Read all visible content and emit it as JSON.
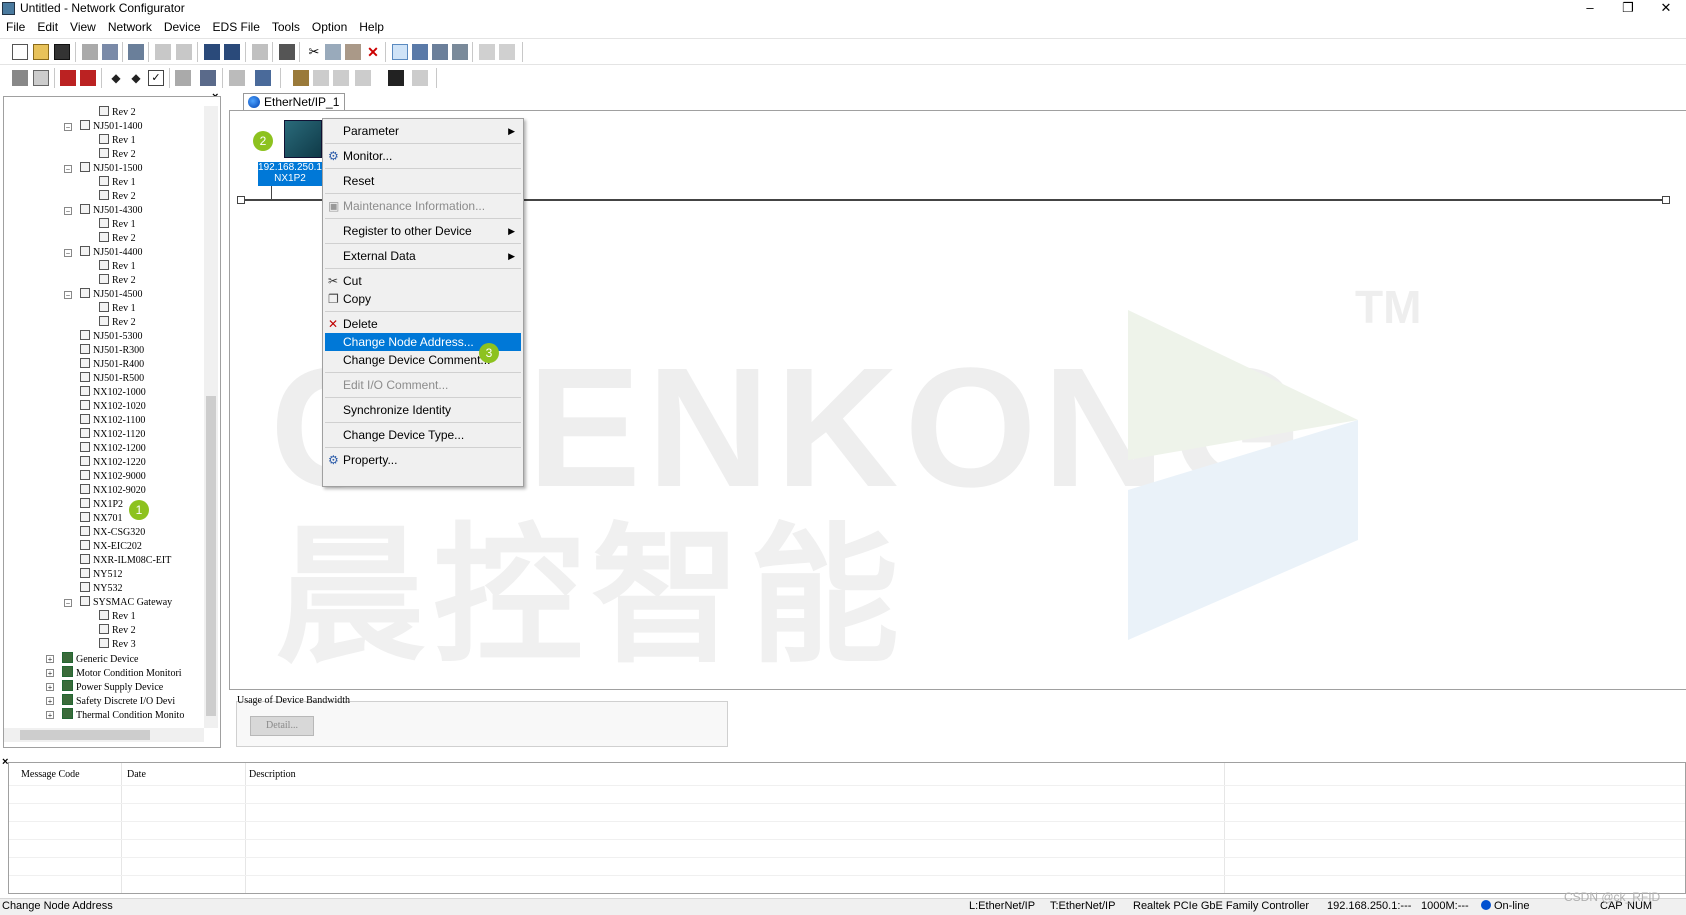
{
  "window": {
    "title": "Untitled - Network Configurator",
    "min": "–",
    "max": "❐",
    "close": "✕"
  },
  "menu": [
    "File",
    "Edit",
    "View",
    "Network",
    "Device",
    "EDS File",
    "Tools",
    "Option",
    "Help"
  ],
  "tab": {
    "label": "EtherNet/IP_1"
  },
  "tree": {
    "close": "×",
    "rows": [
      {
        "kind": "rev",
        "label": "Rev 2"
      },
      {
        "kind": "dev",
        "label": "NJ501-1400"
      },
      {
        "kind": "rev",
        "label": "Rev 1"
      },
      {
        "kind": "rev",
        "label": "Rev 2"
      },
      {
        "kind": "dev",
        "label": "NJ501-1500"
      },
      {
        "kind": "rev",
        "label": "Rev 1"
      },
      {
        "kind": "rev",
        "label": "Rev 2"
      },
      {
        "kind": "dev",
        "label": "NJ501-4300"
      },
      {
        "kind": "rev",
        "label": "Rev 1"
      },
      {
        "kind": "rev",
        "label": "Rev 2"
      },
      {
        "kind": "dev",
        "label": "NJ501-4400"
      },
      {
        "kind": "rev",
        "label": "Rev 1"
      },
      {
        "kind": "rev",
        "label": "Rev 2"
      },
      {
        "kind": "dev",
        "label": "NJ501-4500"
      },
      {
        "kind": "rev",
        "label": "Rev 1"
      },
      {
        "kind": "rev",
        "label": "Rev 2"
      },
      {
        "kind": "leaf",
        "label": "NJ501-5300"
      },
      {
        "kind": "leaf",
        "label": "NJ501-R300"
      },
      {
        "kind": "leaf",
        "label": "NJ501-R400"
      },
      {
        "kind": "leaf",
        "label": "NJ501-R500"
      },
      {
        "kind": "leaf",
        "label": "NX102-1000"
      },
      {
        "kind": "leaf",
        "label": "NX102-1020"
      },
      {
        "kind": "leaf",
        "label": "NX102-1100"
      },
      {
        "kind": "leaf",
        "label": "NX102-1120"
      },
      {
        "kind": "leaf",
        "label": "NX102-1200"
      },
      {
        "kind": "leaf",
        "label": "NX102-1220"
      },
      {
        "kind": "leaf",
        "label": "NX102-9000"
      },
      {
        "kind": "leaf",
        "label": "NX102-9020"
      },
      {
        "kind": "leaf",
        "label": "NX1P2"
      },
      {
        "kind": "leaf",
        "label": "NX701"
      },
      {
        "kind": "leaf",
        "label": "NX-CSG320"
      },
      {
        "kind": "leaf",
        "label": "NX-EIC202"
      },
      {
        "kind": "leaf",
        "label": "NXR-ILM08C-EIT"
      },
      {
        "kind": "leaf",
        "label": "NY512"
      },
      {
        "kind": "leaf",
        "label": "NY532"
      },
      {
        "kind": "dev",
        "label": "SYSMAC Gateway"
      },
      {
        "kind": "rev",
        "label": "Rev 1"
      },
      {
        "kind": "rev",
        "label": "Rev 2"
      },
      {
        "kind": "rev",
        "label": "Rev 3"
      },
      {
        "kind": "group",
        "label": "Generic Device"
      },
      {
        "kind": "group",
        "label": "Motor Condition Monitori"
      },
      {
        "kind": "group",
        "label": "Power Supply Device"
      },
      {
        "kind": "group",
        "label": "Safety Discrete I/O Devi"
      },
      {
        "kind": "group",
        "label": "Thermal Condition Monito"
      }
    ]
  },
  "badges": {
    "one": "1",
    "two": "2",
    "three": "3"
  },
  "device": {
    "ip": "192.168.250.1",
    "name": "NX1P2"
  },
  "watermark": {
    "text": "CHENKONG",
    "tm": "TM",
    "cn": "晨控智能"
  },
  "context_menu": {
    "items": [
      {
        "label": "Parameter",
        "submenu": true
      },
      {
        "sep": true
      },
      {
        "label": "Monitor...",
        "icon": "monitor-icon"
      },
      {
        "sep": true
      },
      {
        "label": "Reset"
      },
      {
        "sep": true
      },
      {
        "label": "Maintenance Information...",
        "disabled": true,
        "icon": "maintenance-icon"
      },
      {
        "sep": true
      },
      {
        "label": "Register to other Device",
        "submenu": true
      },
      {
        "sep": true
      },
      {
        "label": "External Data",
        "submenu": true
      },
      {
        "sep": true
      },
      {
        "label": "Cut",
        "icon": "cut-icon"
      },
      {
        "label": "Copy",
        "icon": "copy-icon"
      },
      {
        "sep": true
      },
      {
        "label": "Delete",
        "icon": "delete-icon"
      },
      {
        "label": "Change Node Address...",
        "highlighted": true
      },
      {
        "label": "Change Device Comment..."
      },
      {
        "sep": true
      },
      {
        "label": "Edit I/O Comment...",
        "disabled": true
      },
      {
        "sep": true
      },
      {
        "label": "Synchronize Identity"
      },
      {
        "sep": true
      },
      {
        "label": "Change Device Type..."
      },
      {
        "sep": true
      },
      {
        "label": "Property...",
        "icon": "property-icon"
      }
    ]
  },
  "bandwidth": {
    "label": "Usage of Device Bandwidth",
    "detail_button": "Detail..."
  },
  "messages": {
    "close": "×",
    "columns": [
      "Message Code",
      "Date",
      "Description"
    ]
  },
  "status": {
    "left": "Change Node Address",
    "cells": [
      "L:EtherNet/IP",
      "T:EtherNet/IP",
      "Realtek PCIe GbE Family Controller",
      "192.168.250.1:---",
      "1000M:---",
      "On-line",
      "CAP",
      "NUM"
    ],
    "watermark": "CSDN @ck_RFID"
  }
}
